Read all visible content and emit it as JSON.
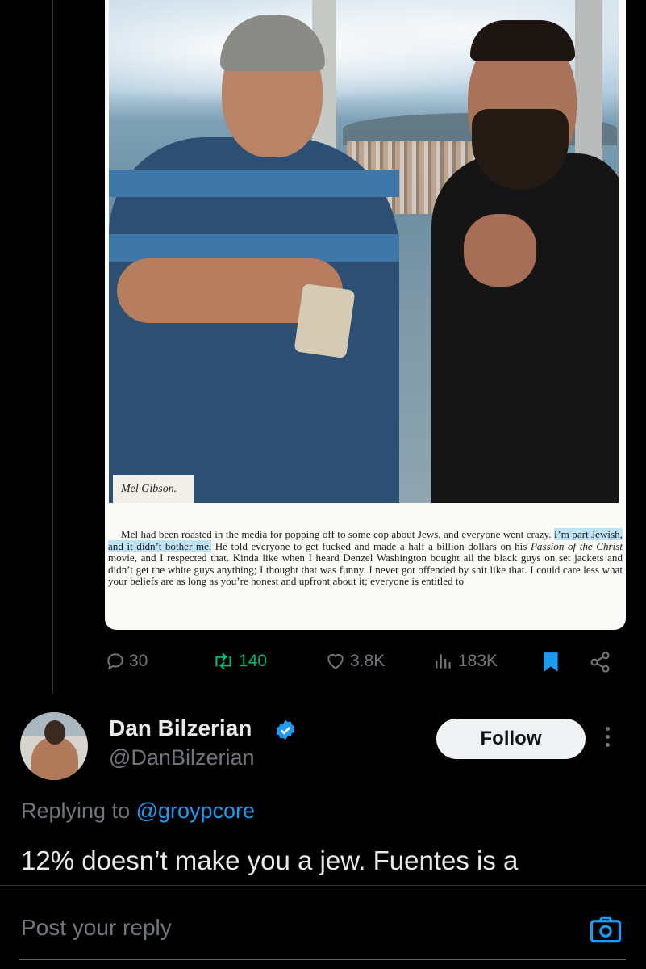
{
  "media": {
    "caption": "Mel Gibson.",
    "text_before": "Mel had been roasted in the media for popping off to some cop about Jews, and everyone went crazy. ",
    "text_highlight": "I’m part Jewish, and it didn’t bother me.",
    "text_mid": " He told everyone to get fucked and made a half a billion dollars on his ",
    "text_italic": "Passion of the Christ",
    "text_after": " movie, and I respected that. Kinda like when I heard Denzel Washington bought all the black guys on set jackets and didn’t get the white guys anything; I thought that was funny. I never got offended by shit like that. I could care less what your beliefs are as long as you’re honest and upfront about it; everyone is entitled to"
  },
  "actions": {
    "replies": "30",
    "reposts": "140",
    "likes": "3.8K",
    "views": "183K"
  },
  "reply": {
    "name": "Dan Bilzerian",
    "handle": "@DanBilzerian",
    "follow_label": "Follow",
    "replying_prefix": "Replying to ",
    "replying_to": "@groypcore",
    "text": "12% doesn’t make you a jew. Fuentes is a"
  },
  "composer": {
    "placeholder": "Post your reply"
  },
  "colors": {
    "accent": "#1d9bf0",
    "repost_green": "#00ba7c",
    "muted": "#71767b",
    "background": "#000000"
  },
  "icons": [
    "reply-icon",
    "repost-icon",
    "like-icon",
    "views-icon",
    "bookmark-icon",
    "share-icon",
    "verified-icon",
    "more-icon",
    "camera-icon"
  ]
}
